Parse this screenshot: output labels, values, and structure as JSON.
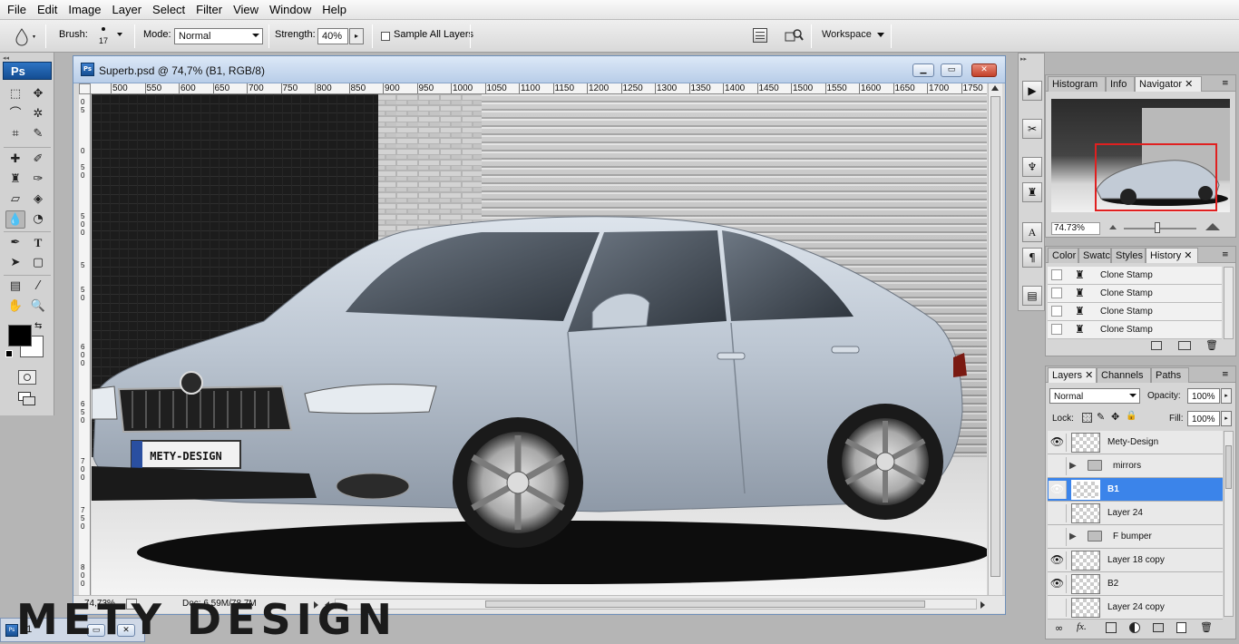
{
  "menu": [
    "File",
    "Edit",
    "Image",
    "Layer",
    "Select",
    "Filter",
    "View",
    "Window",
    "Help"
  ],
  "options": {
    "brush_label": "Brush:",
    "brush_size": "17",
    "mode_label": "Mode:",
    "mode_value": "Normal",
    "strength_label": "Strength:",
    "strength_value": "40%",
    "sample_all_layers": "Sample All Layers",
    "workspace": "Workspace"
  },
  "tools": {
    "badge": "Ps"
  },
  "document": {
    "title": "Superb.psd @ 74,7% (B1, RGB/8)",
    "zoom": "74,73%",
    "doc_info": "Doc: 6,59M/78,7M",
    "ruler_ticks": [
      "500",
      "550",
      "600",
      "650",
      "700",
      "750",
      "800",
      "850",
      "900",
      "950",
      "1000",
      "1050",
      "1100",
      "1150",
      "1200",
      "1250",
      "1300",
      "1350",
      "1400",
      "1450",
      "1500",
      "1550",
      "1600",
      "1650",
      "1700",
      "1750"
    ],
    "plate_text": "METY-DESIGN"
  },
  "navigator": {
    "tabs": [
      "Histogram",
      "Info",
      "Navigator"
    ],
    "zoom": "74.73%"
  },
  "history": {
    "tabs": [
      "Color",
      "Swatc",
      "Styles",
      "History"
    ],
    "items": [
      "Clone Stamp",
      "Clone Stamp",
      "Clone Stamp",
      "Clone Stamp"
    ]
  },
  "layers": {
    "tabs": [
      "Layers",
      "Channels",
      "Paths"
    ],
    "blend_mode": "Normal",
    "opacity_label": "Opacity:",
    "opacity_value": "100%",
    "lock_label": "Lock:",
    "fill_label": "Fill:",
    "fill_value": "100%",
    "rows": [
      {
        "name": "Mety-Design",
        "visible": true,
        "type": "layer"
      },
      {
        "name": "mirrors",
        "visible": false,
        "type": "group"
      },
      {
        "name": "B1",
        "visible": true,
        "type": "layer",
        "selected": true
      },
      {
        "name": "Layer 24",
        "visible": false,
        "type": "layer"
      },
      {
        "name": "F bumper",
        "visible": false,
        "type": "group"
      },
      {
        "name": "Layer 18 copy",
        "visible": true,
        "type": "layer"
      },
      {
        "name": "B2",
        "visible": true,
        "type": "layer"
      },
      {
        "name": "Layer 24 copy",
        "visible": false,
        "type": "layer"
      }
    ]
  },
  "taskbar": {
    "label": "21"
  },
  "watermark": "METY DESIGN",
  "colors": {
    "accent": "#3b84ea",
    "car": "#c2cbd6",
    "foreground": "#000000",
    "background": "#ffffff"
  }
}
